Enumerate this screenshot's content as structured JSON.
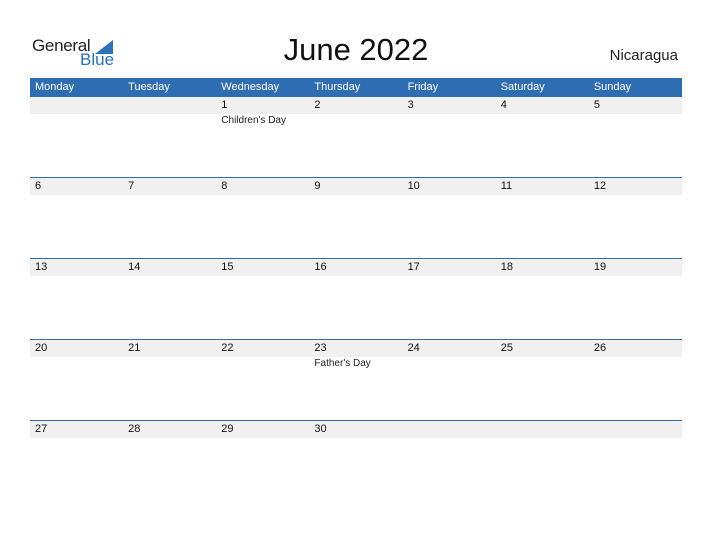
{
  "logo": {
    "general": "General",
    "blue": "Blue",
    "accent": "#2b73b6"
  },
  "title": "June 2022",
  "country": "Nicaragua",
  "colors": {
    "header": "#2e6db2",
    "daterow": "#f0f0f0"
  },
  "weekdays": [
    "Monday",
    "Tuesday",
    "Wednesday",
    "Thursday",
    "Friday",
    "Saturday",
    "Sunday"
  ],
  "weeks": [
    {
      "dates": [
        "",
        "",
        "1",
        "2",
        "3",
        "4",
        "5"
      ],
      "events": [
        "",
        "",
        "Children's Day",
        "",
        "",
        "",
        ""
      ]
    },
    {
      "dates": [
        "6",
        "7",
        "8",
        "9",
        "10",
        "11",
        "12"
      ],
      "events": [
        "",
        "",
        "",
        "",
        "",
        "",
        ""
      ]
    },
    {
      "dates": [
        "13",
        "14",
        "15",
        "16",
        "17",
        "18",
        "19"
      ],
      "events": [
        "",
        "",
        "",
        "",
        "",
        "",
        ""
      ]
    },
    {
      "dates": [
        "20",
        "21",
        "22",
        "23",
        "24",
        "25",
        "26"
      ],
      "events": [
        "",
        "",
        "",
        "Father's Day",
        "",
        "",
        ""
      ]
    },
    {
      "dates": [
        "27",
        "28",
        "29",
        "30",
        "",
        "",
        ""
      ],
      "events": [
        "",
        "",
        "",
        "",
        "",
        "",
        ""
      ]
    }
  ]
}
